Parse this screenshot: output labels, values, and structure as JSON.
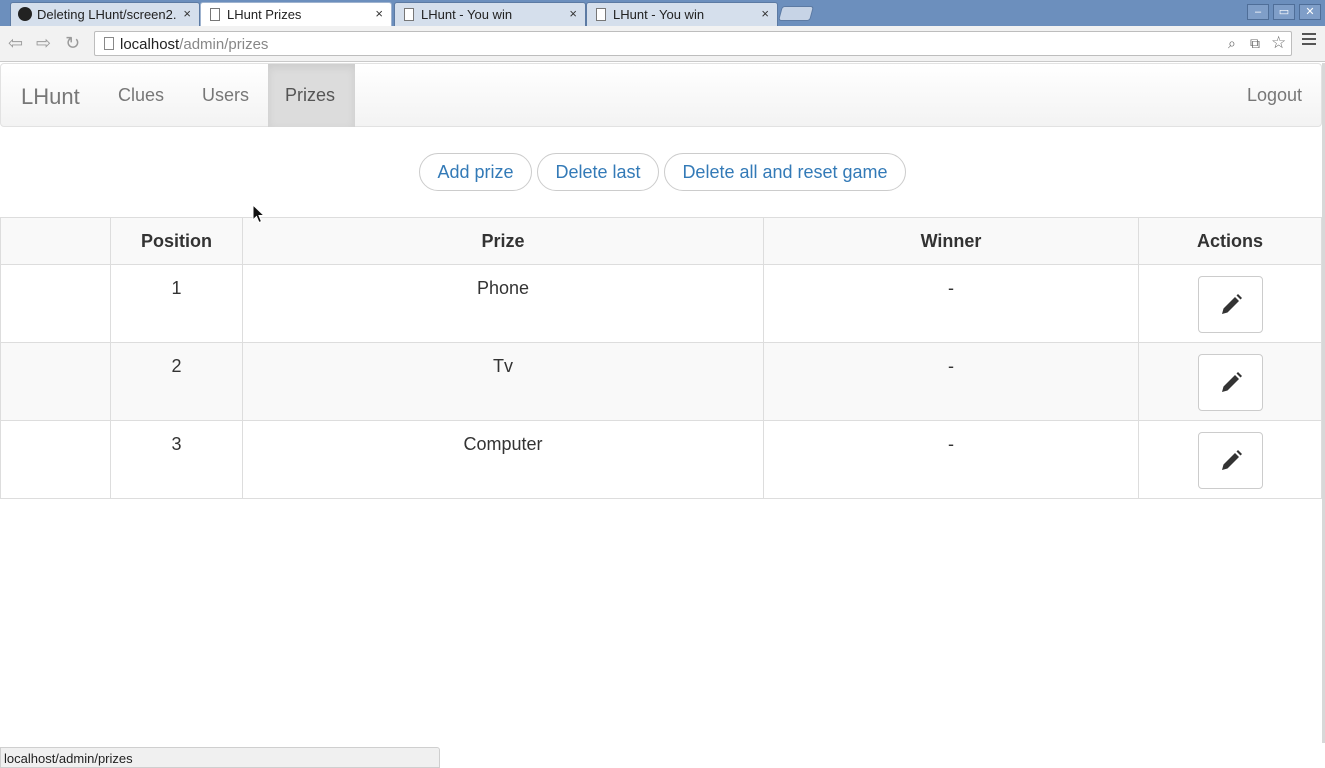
{
  "browser": {
    "tabs": [
      {
        "title": "Deleting LHunt/screen2.",
        "icon": "github-icon"
      },
      {
        "title": "LHunt Prizes",
        "icon": "page-icon"
      },
      {
        "title": "LHunt - You win",
        "icon": "page-icon"
      },
      {
        "title": "LHunt - You win",
        "icon": "page-icon"
      }
    ],
    "tab_close": "×",
    "window_buttons": {
      "minimize": "–",
      "restore": "▭",
      "close": "✕"
    },
    "url_host": "localhost",
    "url_path": "/admin/prizes",
    "status_text": "localhost/admin/prizes"
  },
  "nav": {
    "brand": "LHunt",
    "links": [
      "Clues",
      "Users",
      "Prizes"
    ],
    "active": "Prizes",
    "logout": "Logout"
  },
  "actions": {
    "add": "Add prize",
    "delete_last": "Delete last",
    "reset": "Delete all and reset game"
  },
  "table": {
    "headers": [
      "",
      "Position",
      "Prize",
      "Winner",
      "Actions"
    ],
    "rows": [
      {
        "position": "1",
        "prize": "Phone",
        "winner": "-"
      },
      {
        "position": "2",
        "prize": "Tv",
        "winner": "-"
      },
      {
        "position": "3",
        "prize": "Computer",
        "winner": "-"
      }
    ]
  },
  "colors": {
    "link": "#337ab7",
    "muted": "#777777",
    "titlebar": "#6c8fbd"
  }
}
